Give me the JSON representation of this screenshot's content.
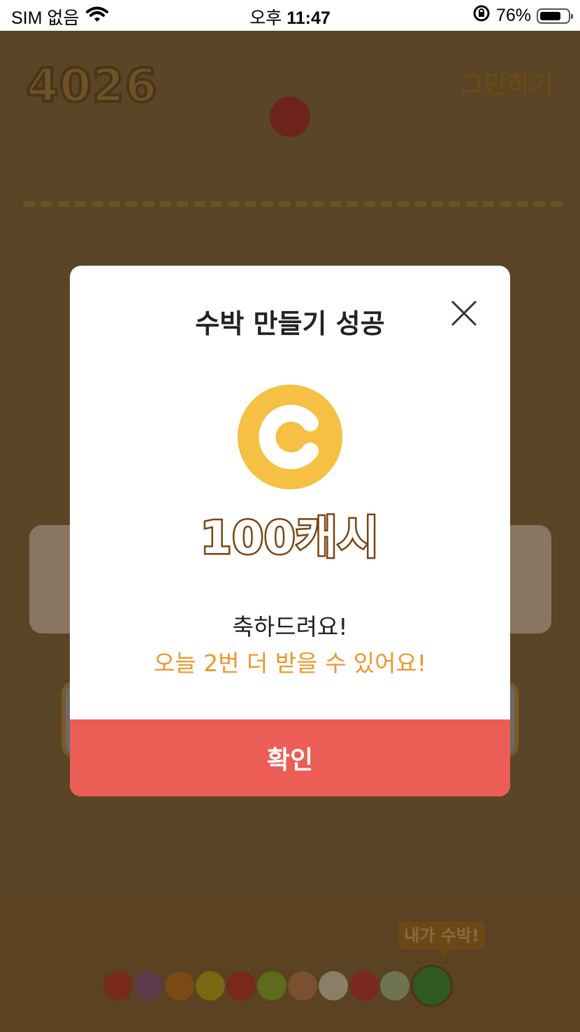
{
  "status_bar": {
    "carrier": "SIM 없음",
    "time_prefix": "오후",
    "time": "11:47",
    "battery": "76%",
    "battery_level": 0.76
  },
  "game": {
    "score": "4026",
    "quit_label": "그만하기",
    "tooltip": "내가 수박!",
    "colors": {
      "background": "#5b4527",
      "fruit_colors": [
        "#7a2a1c",
        "#5d3a4a",
        "#7a4a14",
        "#7a6810",
        "#7a2818",
        "#5e6a1c",
        "#7a5030",
        "#8a7e66",
        "#7a2820",
        "#6e7450",
        "#2f5a22"
      ]
    }
  },
  "modal": {
    "title": "수박 만들기 성공",
    "coin_letter": "C",
    "reward": "100캐시",
    "message": "축하드려요!",
    "sub_message": "오늘 2번 더 받을 수 있어요!",
    "confirm_label": "확인",
    "colors": {
      "coin": "#f5c043",
      "accent_text": "#f0962c",
      "confirm_button": "#ec5e55"
    }
  }
}
